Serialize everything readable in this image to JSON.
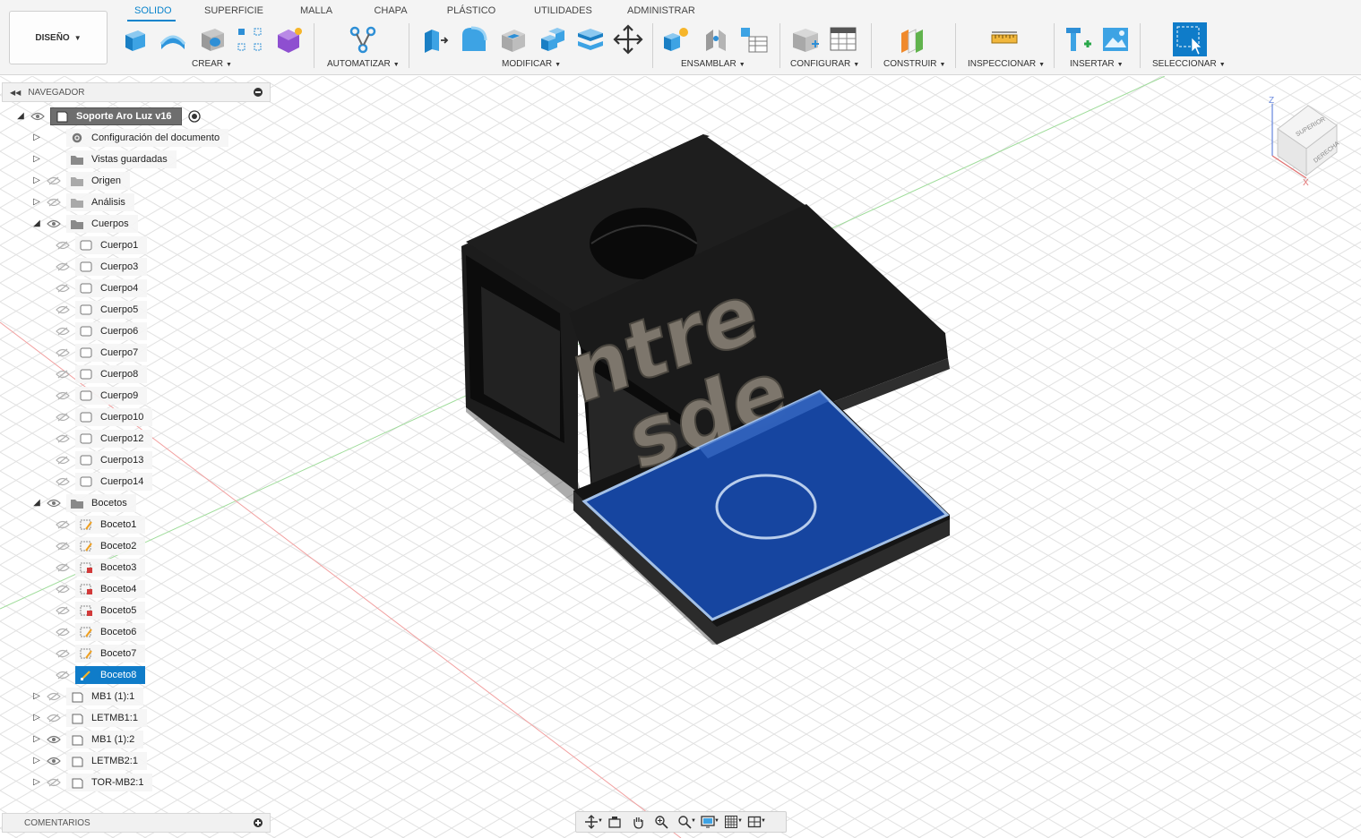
{
  "workspace": {
    "label": "DISEÑO"
  },
  "tabs": [
    {
      "label": "SOLIDO",
      "active": true
    },
    {
      "label": "SUPERFICIE"
    },
    {
      "label": "MALLA"
    },
    {
      "label": "CHAPA"
    },
    {
      "label": "PLÁSTICO"
    },
    {
      "label": "UTILIDADES"
    },
    {
      "label": "ADMINISTRAR"
    }
  ],
  "groups": {
    "crear": "CREAR",
    "automatizar": "AUTOMATIZAR",
    "modificar": "MODIFICAR",
    "ensamblar": "ENSAMBLAR",
    "configurar": "CONFIGURAR",
    "construir": "CONSTRUIR",
    "inspeccionar": "INSPECCIONAR",
    "insertar": "INSERTAR",
    "seleccionar": "SELECCIONAR"
  },
  "navigator": {
    "title": "NAVEGADOR",
    "root": "Soporte Aro Luz v16",
    "items": {
      "config": "Configuración del documento",
      "vistas": "Vistas guardadas",
      "origen": "Origen",
      "analisis": "Análisis",
      "cuerpos": "Cuerpos",
      "bocetos": "Bocetos"
    },
    "bodies": [
      "Cuerpo1",
      "Cuerpo3",
      "Cuerpo4",
      "Cuerpo5",
      "Cuerpo6",
      "Cuerpo7",
      "Cuerpo8",
      "Cuerpo9",
      "Cuerpo10",
      "Cuerpo12",
      "Cuerpo13",
      "Cuerpo14"
    ],
    "sketches": [
      "Boceto1",
      "Boceto2",
      "Boceto3",
      "Boceto4",
      "Boceto5",
      "Boceto6",
      "Boceto7",
      "Boceto8"
    ],
    "components": [
      "MB1 (1):1",
      "LETMB1:1",
      "MB1 (1):2",
      "LETMB2:1",
      "TOR-MB2:1"
    ]
  },
  "comments": {
    "title": "COMENTARIOS"
  },
  "model": {
    "text_line1": "ntre",
    "text_line2": "sde"
  },
  "viewcube": {
    "top": "SUPERIOR",
    "right": "DERECHA",
    "axis_z": "Z",
    "axis_x": "X"
  },
  "colors": {
    "accent": "#0a84cc",
    "selection": "#0f7cc9",
    "sketch_fill": "#1747a6",
    "model": "#1c1c1c"
  }
}
